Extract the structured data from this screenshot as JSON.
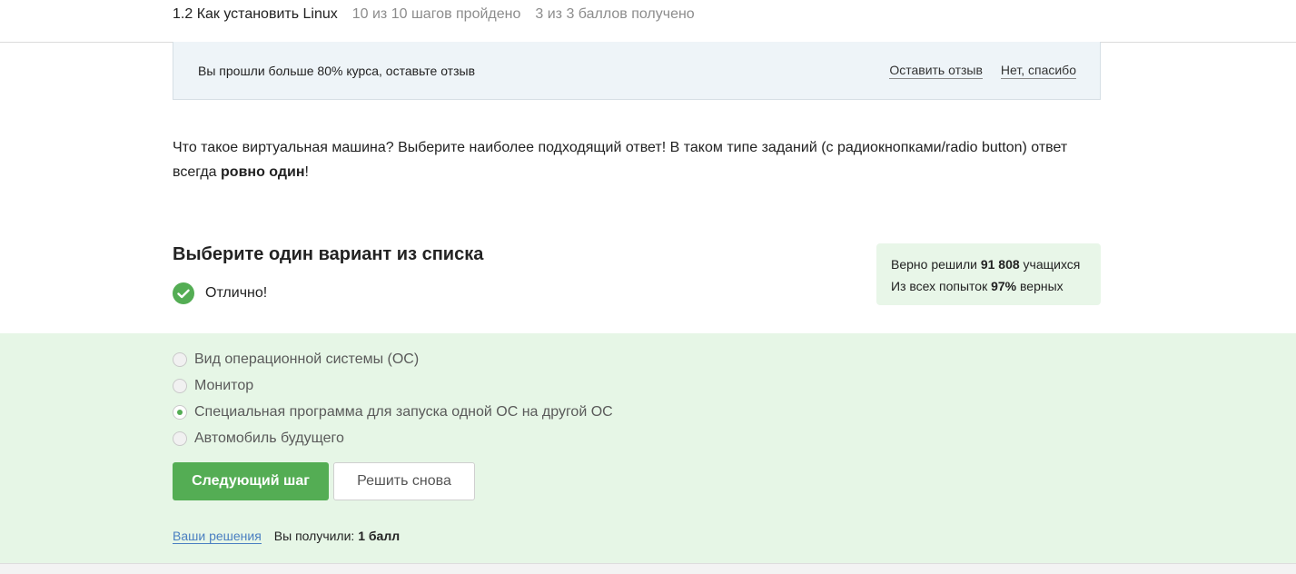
{
  "header": {
    "lesson_title": "1.2 Как установить Linux",
    "steps_progress": "10 из 10 шагов пройдено",
    "score_progress": "3 из 3 баллов  получено"
  },
  "feedback_banner": {
    "message": "Вы прошли больше 80% курса, оставьте отзыв",
    "leave_review": "Оставить отзыв",
    "decline": "Нет, спасибо"
  },
  "question": {
    "text_part1": "Что такое виртуальная машина? Выберите наиболее подходящий ответ! В таком типе заданий (с радиокнопками/radio button) ответ всегда ",
    "text_bold": "ровно один",
    "text_part2": "!"
  },
  "task": {
    "title": "Выберите один вариант из списка",
    "result": "Отлично!"
  },
  "stats": {
    "solved_prefix": "Верно решили ",
    "solved_count": "91 808",
    "solved_suffix": " учащихся",
    "attempts_prefix": "Из всех попыток ",
    "attempts_percent": "97%",
    "attempts_suffix": " верных"
  },
  "options": [
    {
      "label": "Вид операционной системы (ОС)",
      "selected": false
    },
    {
      "label": "Монитор",
      "selected": false
    },
    {
      "label": "Специальная программа для запуска одной ОС на другой ОС",
      "selected": true
    },
    {
      "label": "Автомобиль будущего",
      "selected": false
    }
  ],
  "buttons": {
    "next": "Следующий шаг",
    "retry": "Решить снова"
  },
  "footer": {
    "solutions_link": "Ваши решения",
    "score_prefix": "Вы получили: ",
    "score_value": "1 балл"
  },
  "colors": {
    "accent_green": "#54ad54",
    "answer_bg": "#e6f6e6",
    "banner_bg": "#eef4f8",
    "link_blue": "#4a7fc1"
  }
}
